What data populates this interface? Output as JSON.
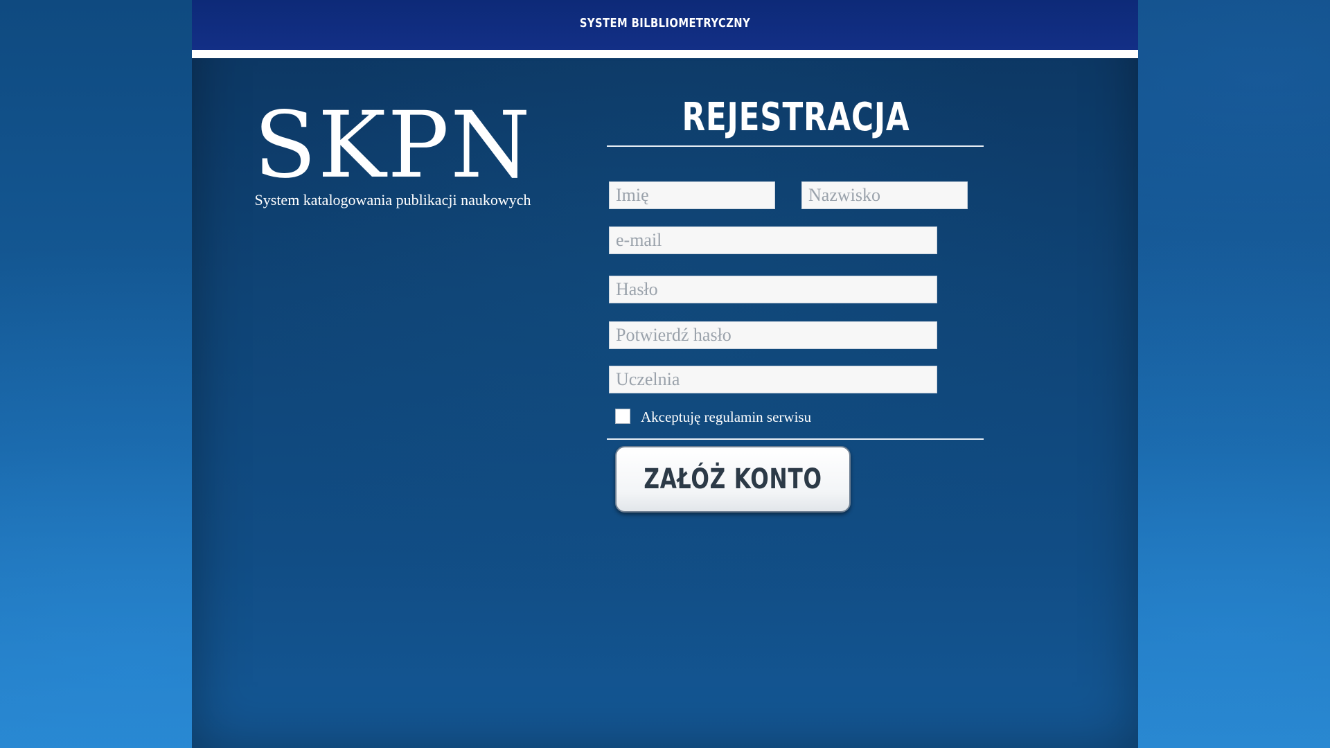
{
  "header": {
    "title": "SYSTEM BILBLIOMETRYCZNY"
  },
  "logo": {
    "title": "SKPN",
    "subtitle": "System katalogowania publikacji naukowych"
  },
  "form": {
    "title": "REJESTRACJA",
    "fields": {
      "first_name": {
        "placeholder": "Imię",
        "value": ""
      },
      "last_name": {
        "placeholder": "Nazwisko",
        "value": ""
      },
      "email": {
        "placeholder": "e-mail",
        "value": ""
      },
      "password": {
        "placeholder": "Hasło",
        "value": ""
      },
      "password_confirm": {
        "placeholder": "Potwierdź hasło",
        "value": ""
      },
      "university": {
        "placeholder": "Uczelnia",
        "value": ""
      }
    },
    "terms": {
      "label": "Akceptuję regulamin serwisu",
      "checked": false
    },
    "submit_label": "ZAŁÓŻ KONTO"
  },
  "colors": {
    "header_bg": "#132f86",
    "panel_bg": "#0f4476",
    "page_bg": "#17609f",
    "button_text": "#2c3a47"
  }
}
